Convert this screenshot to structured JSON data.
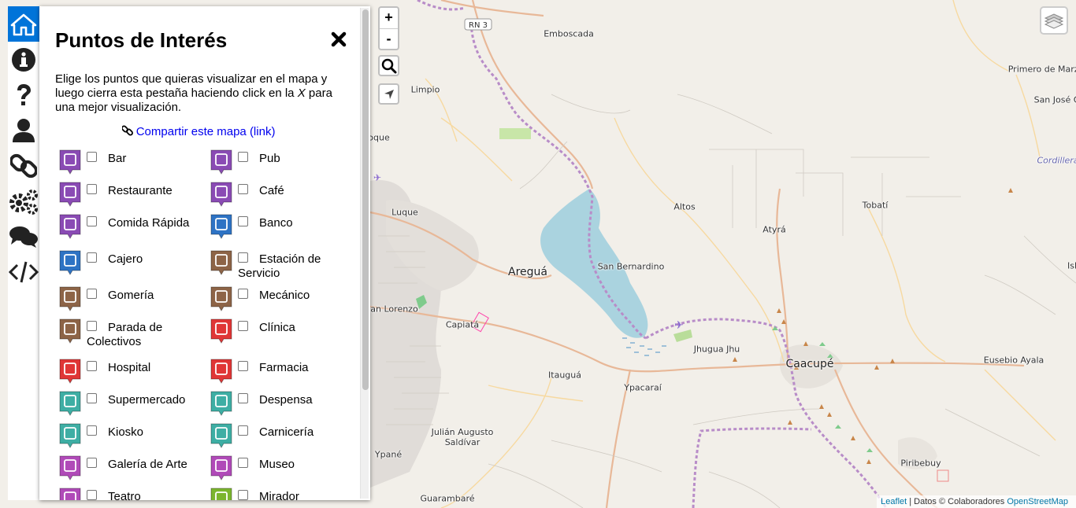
{
  "map": {
    "road_label": "RN 3",
    "places": [
      {
        "id": "emboscada",
        "name": "Emboscada"
      },
      {
        "id": "limpio",
        "name": "Limpio"
      },
      {
        "id": "luque",
        "name": "Luque"
      },
      {
        "id": "aregua",
        "name": "Areguá"
      },
      {
        "id": "san-bernardino",
        "name": "San Bernardino"
      },
      {
        "id": "altos",
        "name": "Altos"
      },
      {
        "id": "atyra",
        "name": "Atyrá"
      },
      {
        "id": "tobati",
        "name": "Tobatí"
      },
      {
        "id": "primero-de-marzo",
        "name": "Primero de Marzo"
      },
      {
        "id": "san-jose",
        "name": "San José O"
      },
      {
        "id": "cordillera",
        "name": "Cordillera"
      },
      {
        "id": "san-lorenzo",
        "name": "San Lorenzo"
      },
      {
        "id": "capiata",
        "name": "Capiatá"
      },
      {
        "id": "jhugua-jhu",
        "name": "Jhugua Jhu"
      },
      {
        "id": "caacupe",
        "name": "Caacupé"
      },
      {
        "id": "eusebio-ayala",
        "name": "Eusebio Ayala"
      },
      {
        "id": "itaugua",
        "name": "Itauguá"
      },
      {
        "id": "ypacarai",
        "name": "Ypacaraí"
      },
      {
        "id": "julian",
        "name": "Julián Augusto\nSaldívar"
      },
      {
        "id": "ypane",
        "name": "Ypané"
      },
      {
        "id": "piribebuy",
        "name": "Piribebuy"
      },
      {
        "id": "guarambare",
        "name": "Guarambaré"
      },
      {
        "id": "isl",
        "name": "Isl"
      },
      {
        "id": "oque",
        "name": "oque"
      }
    ],
    "zoom_in": "+",
    "zoom_out": "-",
    "attribution": {
      "leaflet": "Leaflet",
      "separator": " | Datos © Colaboradores ",
      "osm": "OpenStreetMap"
    }
  },
  "sidebar": {
    "tabs": [
      {
        "name": "home-icon",
        "active": true
      },
      {
        "name": "info-icon",
        "active": false
      },
      {
        "name": "help-icon",
        "active": false
      },
      {
        "name": "user-icon",
        "active": false
      },
      {
        "name": "link-icon",
        "active": false
      },
      {
        "name": "settings-icon",
        "active": false
      },
      {
        "name": "comments-icon",
        "active": false
      },
      {
        "name": "code-icon",
        "active": false
      }
    ]
  },
  "panel": {
    "title": "Puntos de Interés",
    "description_part1": "Elige los puntos que quieras visualizar en el mapa y luego cierra esta pestaña haciendo click en la ",
    "description_x": "X",
    "description_part2": " para una mejor visualización.",
    "share_link": "Compartir este mapa (link)",
    "pois": [
      {
        "label": "Bar",
        "icon": "bar-icon",
        "color": "#8a4bb4"
      },
      {
        "label": "Pub",
        "icon": "pub-icon",
        "color": "#8a4bb4"
      },
      {
        "label": "Restaurante",
        "icon": "restaurant-icon",
        "color": "#8a4bb4"
      },
      {
        "label": "Café",
        "icon": "cafe-icon",
        "color": "#8a4bb4"
      },
      {
        "label": "Comida Rápida",
        "icon": "fast-food-icon",
        "color": "#8a4bb4"
      },
      {
        "label": "Banco",
        "icon": "bank-icon",
        "color": "#2e73c4"
      },
      {
        "label": "Cajero",
        "icon": "atm-icon",
        "color": "#2e73c4"
      },
      {
        "label": "Estación de Servicio",
        "icon": "fuel-station-icon",
        "color": "#8d6447"
      },
      {
        "label": "Gomería",
        "icon": "tire-shop-icon",
        "color": "#8d6447"
      },
      {
        "label": "Mecánico",
        "icon": "mechanic-icon",
        "color": "#8d6447"
      },
      {
        "label": "Parada de Colectivos",
        "icon": "bus-stop-icon",
        "color": "#8d6447"
      },
      {
        "label": "Clínica",
        "icon": "clinic-icon",
        "color": "#e03636"
      },
      {
        "label": "Hospital",
        "icon": "hospital-icon",
        "color": "#e03636"
      },
      {
        "label": "Farmacia",
        "icon": "pharmacy-icon",
        "color": "#e03636"
      },
      {
        "label": "Supermercado",
        "icon": "supermarket-icon",
        "color": "#3eaea4"
      },
      {
        "label": "Despensa",
        "icon": "grocery-icon",
        "color": "#3eaea4"
      },
      {
        "label": "Kiosko",
        "icon": "kiosk-icon",
        "color": "#3eaea4"
      },
      {
        "label": "Carnicería",
        "icon": "butcher-icon",
        "color": "#3eaea4"
      },
      {
        "label": "Galería de Arte",
        "icon": "art-gallery-icon",
        "color": "#b04ab8"
      },
      {
        "label": "Museo",
        "icon": "museum-icon",
        "color": "#b04ab8"
      },
      {
        "label": "Teatro",
        "icon": "theater-icon",
        "color": "#b04ab8"
      },
      {
        "label": "Mirador",
        "icon": "viewpoint-icon",
        "color": "#7bb52e"
      }
    ]
  }
}
